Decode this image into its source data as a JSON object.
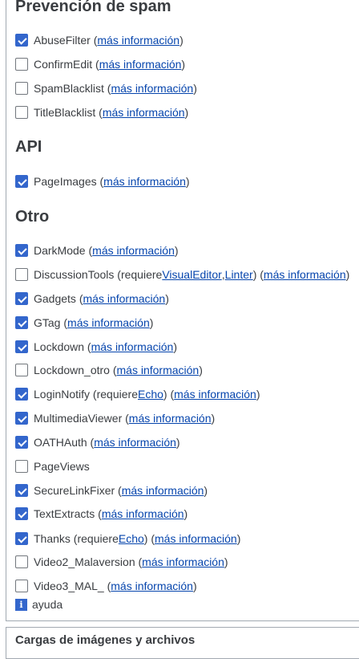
{
  "sections": {
    "spam": {
      "title": "Prevención de spam"
    },
    "api": {
      "title": "API"
    },
    "otro": {
      "title": "Otro"
    },
    "next": {
      "title": "Cargas de imágenes y archivos"
    }
  },
  "common": {
    "more_info": "más información",
    "requires": "requiere"
  },
  "extensions": [
    {
      "name": "AbuseFilter",
      "checked": true
    },
    {
      "name": "ConfirmEdit",
      "checked": false
    },
    {
      "name": "SpamBlacklist",
      "checked": false
    },
    {
      "name": "TitleBlacklist",
      "checked": false
    },
    {
      "name": "PageImages",
      "checked": true
    },
    {
      "name": "DarkMode",
      "checked": true
    },
    {
      "name": "DiscussionTools",
      "checked": false,
      "requires": [
        "VisualEditor",
        "Linter"
      ]
    },
    {
      "name": "Gadgets",
      "checked": true
    },
    {
      "name": "GTag",
      "checked": true
    },
    {
      "name": "Lockdown",
      "checked": true
    },
    {
      "name": "Lockdown_otro",
      "checked": false
    },
    {
      "name": "LoginNotify",
      "checked": true,
      "requires": [
        "Echo"
      ]
    },
    {
      "name": "MultimediaViewer",
      "checked": true
    },
    {
      "name": "OATHAuth",
      "checked": true
    },
    {
      "name": "PageViews",
      "checked": false
    },
    {
      "name": "SecureLinkFixer",
      "checked": true
    },
    {
      "name": "TextExtracts",
      "checked": true
    },
    {
      "name": "Thanks",
      "checked": true,
      "requires": [
        "Echo"
      ]
    },
    {
      "name": "Video2_Malaversion",
      "checked": false
    },
    {
      "name": "Video3_MAL_",
      "checked": false
    }
  ],
  "help": {
    "icon": "info-icon",
    "glyph": "i",
    "label": "ayuda"
  }
}
